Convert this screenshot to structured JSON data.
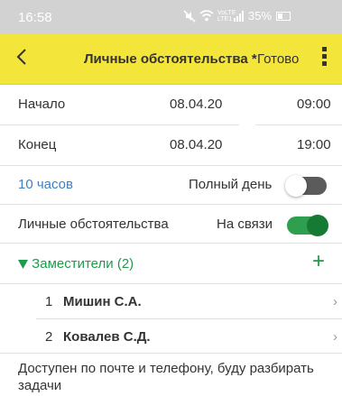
{
  "status_bar": {
    "time": "16:58",
    "volte_top": "VoLTE",
    "lte_bottom": "LTE1",
    "battery": "35%"
  },
  "toolbar": {
    "title": "Личные обстоятельства *",
    "done_label": "Готово"
  },
  "start": {
    "label": "Начало",
    "date": "08.04.20",
    "time": "09:00"
  },
  "end": {
    "label": "Конец",
    "date": "08.04.20",
    "time": "19:00"
  },
  "duration": {
    "text": "10 часов",
    "full_day_label": "Полный день",
    "full_day_on": false
  },
  "type": {
    "label": "Личные обстоятельства",
    "contact_label": "На связи",
    "contact_on": true
  },
  "deputies": {
    "header": "Заместители (2)",
    "add_symbol": "+",
    "items": [
      {
        "num": "1",
        "name": "Мишин С.А."
      },
      {
        "num": "2",
        "name": "Ковалев С.Д."
      }
    ]
  },
  "comment": "Доступен по почте и телефону, буду разбирать задачи",
  "colors": {
    "toolbar": "#f4e53a",
    "statusbar": "#d2d2d2",
    "link": "#3e7fc1",
    "accent_green": "#1e9a4b",
    "toggle_on": "#2e9e4f"
  }
}
